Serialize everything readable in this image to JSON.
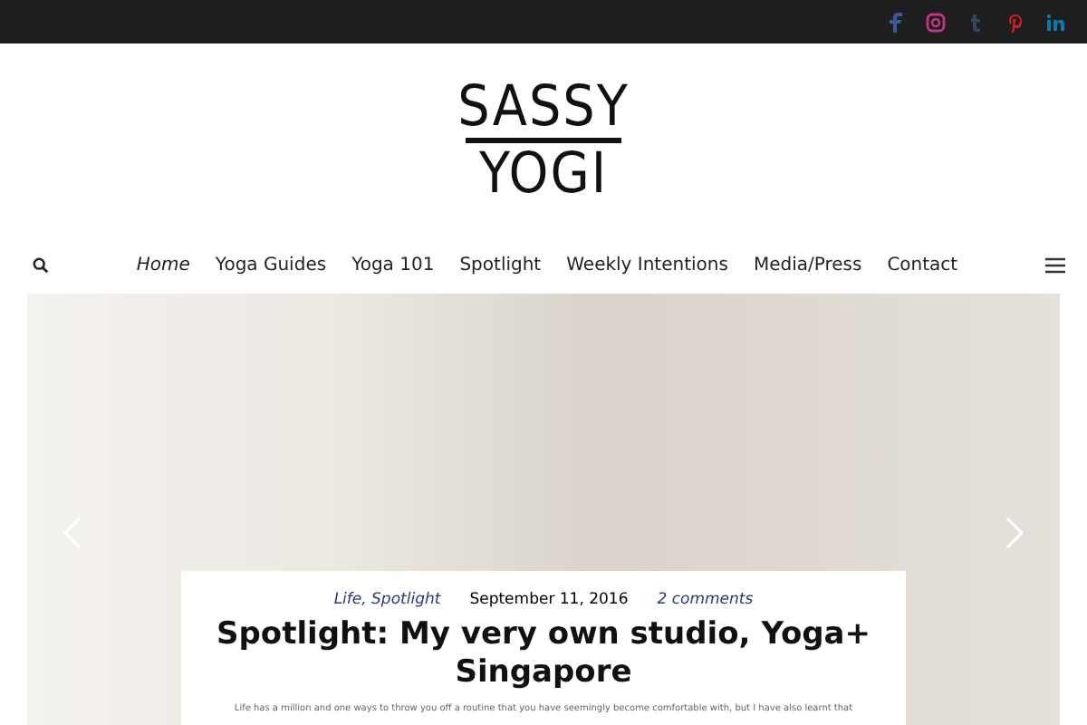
{
  "social": [
    {
      "kind": "facebook",
      "color": "#3b5998"
    },
    {
      "kind": "instagram",
      "color": "#c13584"
    },
    {
      "kind": "tumblr",
      "color": "#35465c"
    },
    {
      "kind": "pinterest",
      "color": "#cb2027"
    },
    {
      "kind": "linkedin",
      "color": "#0e76a8"
    }
  ],
  "logo": {
    "top": "SASSY",
    "bottom": "YOGI"
  },
  "nav": [
    {
      "label": "Home",
      "selected": true
    },
    {
      "label": "Yoga Guides",
      "selected": false
    },
    {
      "label": "Yoga 101",
      "selected": false
    },
    {
      "label": "Spotlight",
      "selected": false
    },
    {
      "label": "Weekly Intentions",
      "selected": false
    },
    {
      "label": "Media/Press",
      "selected": false
    },
    {
      "label": "Contact",
      "selected": false
    }
  ],
  "post": {
    "categories": "Life, Spotlight",
    "date": "September 11, 2016",
    "comments": "2 comments",
    "title": "Spotlight: My very own studio, Yoga+ Singapore",
    "excerpt": "Life has a million and one ways to throw you off a routine that you have seemingly become comfortable with, but I have also learnt that"
  }
}
